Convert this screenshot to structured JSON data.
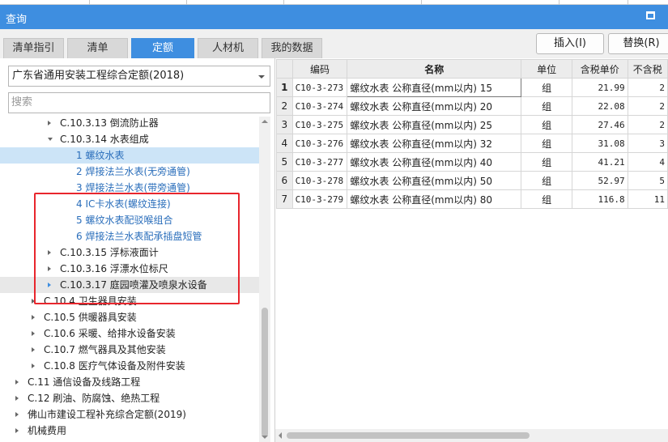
{
  "window": {
    "title": "查询"
  },
  "tabs": [
    {
      "label": "清单指引"
    },
    {
      "label": "清单"
    },
    {
      "label": "定额",
      "active": true
    },
    {
      "label": "人材机"
    },
    {
      "label": "我的数据"
    }
  ],
  "buttons": {
    "insert": "插入(I)",
    "replace": "替换(R)"
  },
  "quota_library": {
    "selected": "广东省通用安装工程综合定额(2018)"
  },
  "search": {
    "placeholder": "搜索"
  },
  "tree": [
    {
      "label": "C.10.3.13 倒流防止器",
      "level": 3,
      "state": "collapsed"
    },
    {
      "label": "C.10.3.14 水表组成",
      "level": 3,
      "state": "expanded"
    },
    {
      "label": "1 螺纹水表",
      "level": 4,
      "state": "leaf",
      "selected": true
    },
    {
      "label": "2 焊接法兰水表(无旁通管)",
      "level": 4,
      "state": "leaf"
    },
    {
      "label": "3 焊接法兰水表(带旁通管)",
      "level": 4,
      "state": "leaf"
    },
    {
      "label": "4 IC卡水表(螺纹连接)",
      "level": 4,
      "state": "leaf"
    },
    {
      "label": "5 螺纹水表配驳喉组合",
      "level": 4,
      "state": "leaf"
    },
    {
      "label": "6 焊接法兰水表配承插盘短管",
      "level": 4,
      "state": "leaf"
    },
    {
      "label": "C.10.3.15 浮标液面计",
      "level": 3,
      "state": "collapsed"
    },
    {
      "label": "C.10.3.16 浮漂水位标尺",
      "level": 3,
      "state": "collapsed"
    },
    {
      "label": "C.10.3.17 庭园喷灌及喷泉水设备",
      "level": 3,
      "state": "collapsed",
      "hover": true
    },
    {
      "label": "C.10.4 卫生器具安装",
      "level": 2,
      "state": "collapsed"
    },
    {
      "label": "C.10.5 供暖器具安装",
      "level": 2,
      "state": "collapsed"
    },
    {
      "label": "C.10.6 采暖、给排水设备安装",
      "level": 2,
      "state": "collapsed"
    },
    {
      "label": "C.10.7 燃气器具及其他安装",
      "level": 2,
      "state": "collapsed"
    },
    {
      "label": "C.10.8 医疗气体设备及附件安装",
      "level": 2,
      "state": "collapsed"
    },
    {
      "label": "C.11 通信设备及线路工程",
      "level": 1,
      "state": "collapsed"
    },
    {
      "label": "C.12 刷油、防腐蚀、绝热工程",
      "level": 1,
      "state": "collapsed"
    },
    {
      "label": "佛山市建设工程补充综合定额(2019)",
      "level": 1,
      "state": "collapsed"
    },
    {
      "label": "机械费用",
      "level": 1,
      "state": "collapsed"
    }
  ],
  "grid": {
    "columns": [
      "编码",
      "名称",
      "单位",
      "含税单价",
      "不含税"
    ],
    "rows": [
      {
        "no": "1",
        "code": "C10-3-273",
        "name": "螺纹水表 公称直径(mm以内) 15",
        "unit": "组",
        "price_tax": "21.99",
        "price_notax": "2"
      },
      {
        "no": "2",
        "code": "C10-3-274",
        "name": "螺纹水表 公称直径(mm以内) 20",
        "unit": "组",
        "price_tax": "22.08",
        "price_notax": "2"
      },
      {
        "no": "3",
        "code": "C10-3-275",
        "name": "螺纹水表 公称直径(mm以内) 25",
        "unit": "组",
        "price_tax": "27.46",
        "price_notax": "2"
      },
      {
        "no": "4",
        "code": "C10-3-276",
        "name": "螺纹水表 公称直径(mm以内) 32",
        "unit": "组",
        "price_tax": "31.08",
        "price_notax": "3"
      },
      {
        "no": "5",
        "code": "C10-3-277",
        "name": "螺纹水表 公称直径(mm以内) 40",
        "unit": "组",
        "price_tax": "41.21",
        "price_notax": "4"
      },
      {
        "no": "6",
        "code": "C10-3-278",
        "name": "螺纹水表 公称直径(mm以内) 50",
        "unit": "组",
        "price_tax": "52.97",
        "price_notax": "5"
      },
      {
        "no": "7",
        "code": "C10-3-279",
        "name": "螺纹水表 公称直径(mm以内) 80",
        "unit": "组",
        "price_tax": "116.8",
        "price_notax": "11"
      }
    ]
  },
  "colors": {
    "accent": "#3e8ee0",
    "highlight_box": "#e8262d",
    "selected_row": "#cce4f7"
  }
}
